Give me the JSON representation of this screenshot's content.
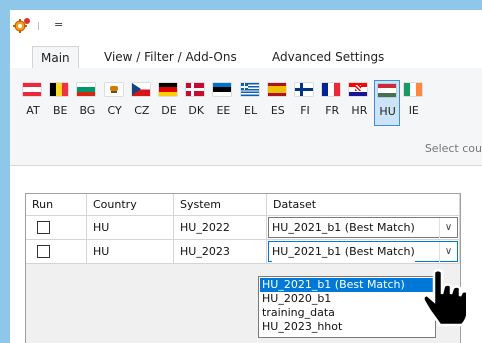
{
  "qat": {
    "dropdown_glyph": "="
  },
  "tabs": [
    {
      "label": "Main",
      "active": true
    },
    {
      "label": "View / Filter / Add-Ons",
      "active": false
    },
    {
      "label": "Advanced Settings",
      "active": false
    }
  ],
  "countries": [
    {
      "code": "AT",
      "icon": "at-flag-icon",
      "selected": false
    },
    {
      "code": "BE",
      "icon": "be-flag-icon",
      "selected": false
    },
    {
      "code": "BG",
      "icon": "bg-flag-icon",
      "selected": false
    },
    {
      "code": "CY",
      "icon": "cy-flag-icon",
      "selected": false
    },
    {
      "code": "CZ",
      "icon": "cz-flag-icon",
      "selected": false
    },
    {
      "code": "DE",
      "icon": "de-flag-icon",
      "selected": false
    },
    {
      "code": "DK",
      "icon": "dk-flag-icon",
      "selected": false
    },
    {
      "code": "EE",
      "icon": "ee-flag-icon",
      "selected": false
    },
    {
      "code": "EL",
      "icon": "el-flag-icon",
      "selected": false
    },
    {
      "code": "ES",
      "icon": "es-flag-icon",
      "selected": false
    },
    {
      "code": "FI",
      "icon": "fi-flag-icon",
      "selected": false
    },
    {
      "code": "FR",
      "icon": "fr-flag-icon",
      "selected": false
    },
    {
      "code": "HR",
      "icon": "hr-flag-icon",
      "selected": false
    },
    {
      "code": "HU",
      "icon": "hu-flag-icon",
      "selected": true
    },
    {
      "code": "IE",
      "icon": "ie-flag-icon",
      "selected": false
    }
  ],
  "ribbon_caption": "Select cou",
  "grid": {
    "headers": [
      "Run",
      "Country",
      "System",
      "Dataset"
    ],
    "rows": [
      {
        "run": false,
        "country": "HU",
        "system": "HU_2022",
        "dataset": "HU_2021_b1 (Best Match)"
      },
      {
        "run": false,
        "country": "HU",
        "system": "HU_2023",
        "dataset": "HU_2021_b1 (Best Match)"
      }
    ]
  },
  "dropdown": {
    "options": [
      "HU_2021_b1 (Best Match)",
      "HU_2020_b1",
      "training_data",
      "HU_2023_hhot"
    ],
    "highlighted": 0
  },
  "colors": {
    "accent": "#0078d7",
    "selected_tab_border": "#3c8fd5",
    "background": "#8ec7e8"
  },
  "combo_arrow_glyph": "∨"
}
